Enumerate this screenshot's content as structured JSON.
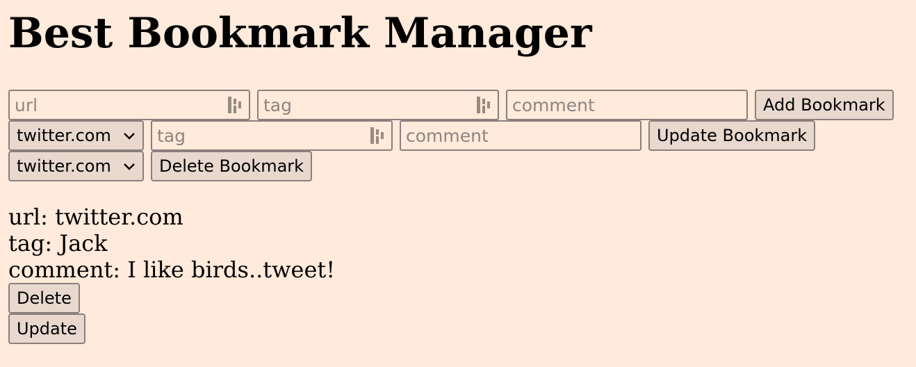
{
  "page": {
    "title": "Best Bookmark Manager"
  },
  "add_form": {
    "url_placeholder": "url",
    "tag_placeholder": "tag",
    "comment_placeholder": "comment",
    "button_label": "Add Bookmark"
  },
  "update_form": {
    "selected_url": "twitter.com",
    "tag_placeholder": "tag",
    "comment_placeholder": "comment",
    "button_label": "Update Bookmark"
  },
  "delete_form": {
    "selected_url": "twitter.com",
    "button_label": "Delete Bookmark"
  },
  "bookmark": {
    "url_line": "url: twitter.com",
    "tag_line": "tag: Jack",
    "comment_line": "comment: I like birds..tweet!",
    "delete_label": "Delete",
    "update_label": "Update"
  },
  "icons": {
    "field_icon": "password-manager-icon",
    "select_icon": "chevron-down-icon"
  },
  "colors": {
    "background": "#ffeadb",
    "button_bg": "#e8d8ce",
    "border": "#8b7f7c",
    "placeholder": "#8e8580"
  }
}
